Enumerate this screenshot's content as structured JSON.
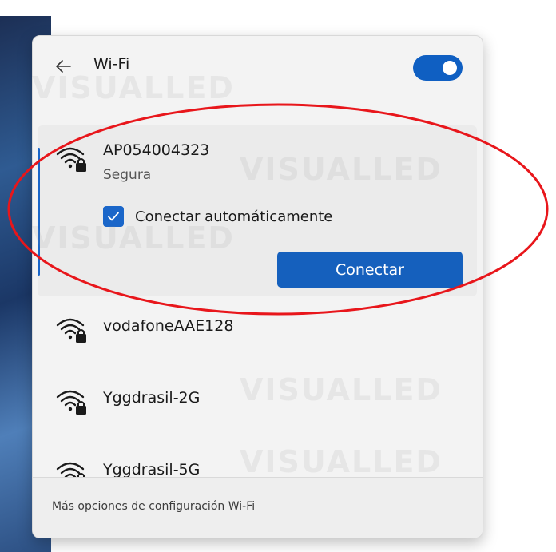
{
  "panel": {
    "title": "Wi-Fi",
    "back_icon": "arrow-left-icon",
    "toggle_on": true
  },
  "selected_network": {
    "name": "AP054004323",
    "status": "Segura",
    "auto_connect_label": "Conectar automáticamente",
    "auto_connect_checked": true,
    "connect_label": "Conectar",
    "icon": "wifi-secured-icon"
  },
  "networks": [
    {
      "name": "vodafoneAAE128",
      "icon": "wifi-secured-icon"
    },
    {
      "name": "Yggdrasil-2G",
      "icon": "wifi-secured-icon"
    },
    {
      "name": "Yggdrasil-5G",
      "icon": "wifi-secured-icon"
    }
  ],
  "footer": {
    "link_label": "Más opciones de configuración Wi-Fi"
  },
  "watermark": {
    "text": "VISUALLED"
  },
  "colors": {
    "accent": "#1560bd",
    "annotation": "#e8161b",
    "panel_bg": "#f3f3f3"
  }
}
